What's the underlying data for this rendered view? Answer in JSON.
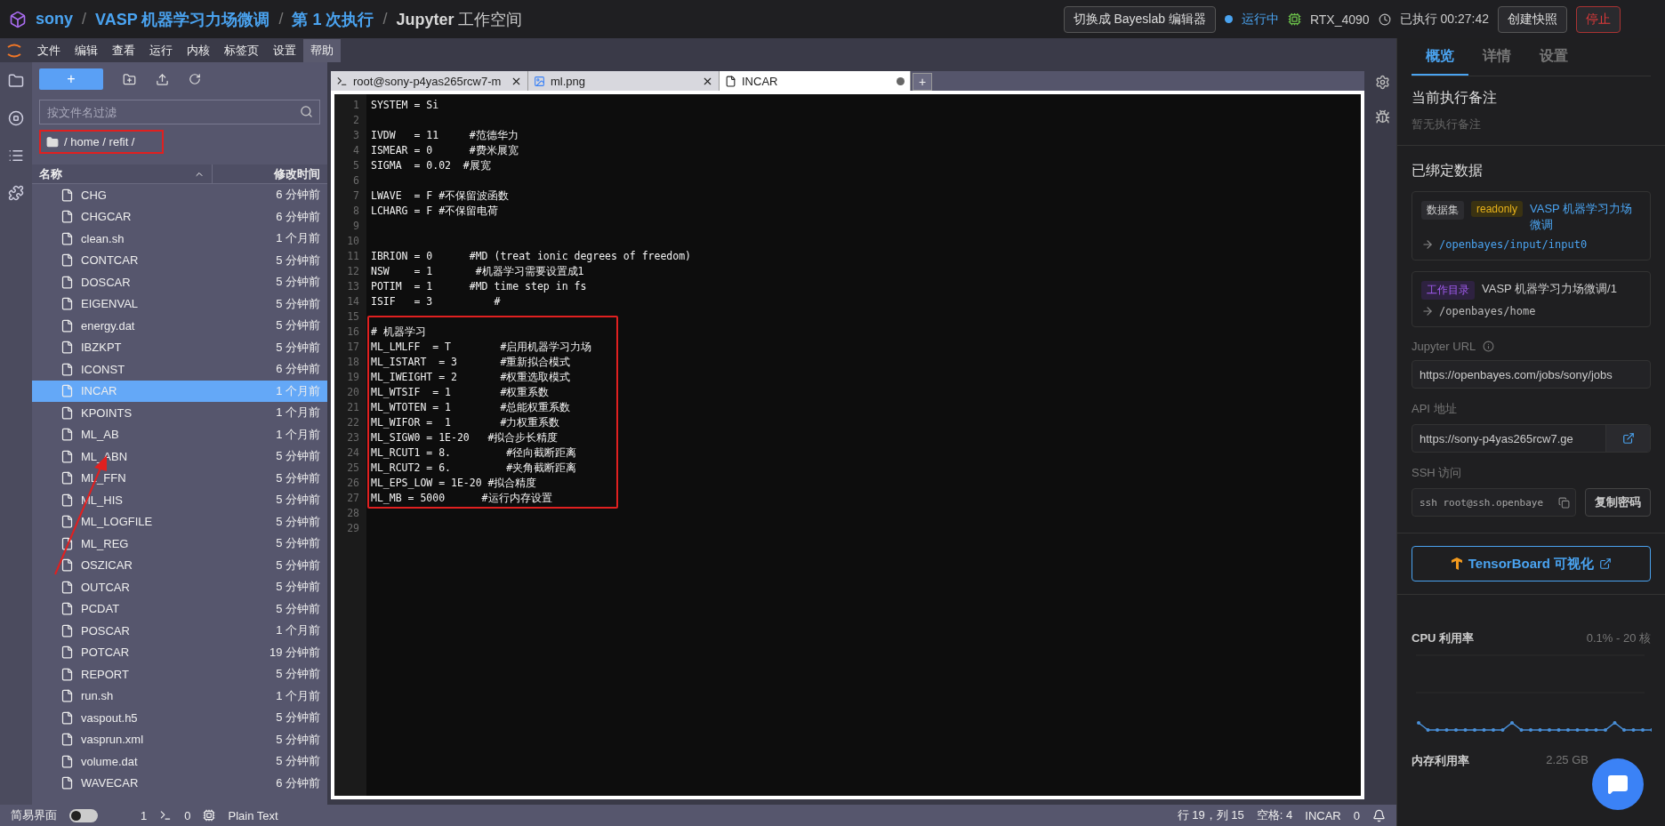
{
  "top_bar": {
    "breadcrumb": [
      {
        "text": "sony"
      },
      {
        "text": "VASP 机器学习力场微调"
      },
      {
        "text": "第 1 次执行"
      },
      {
        "text": "**Jupyter** 工作空间"
      }
    ],
    "separator": "/",
    "switch_button": "切换成 Bayeslab 编辑器",
    "status": {
      "label": "运行中",
      "color": "#4aa3f0"
    },
    "gpu": "RTX_4090",
    "elapsed": "已执行 00:27:42",
    "snapshot_button": "创建快照",
    "stop_button": "停止"
  },
  "menu": [
    {
      "label": "文件",
      "selected": false
    },
    {
      "label": "编辑",
      "selected": false
    },
    {
      "label": "查看",
      "selected": false
    },
    {
      "label": "运行",
      "selected": false
    },
    {
      "label": "内核",
      "selected": false
    },
    {
      "label": "标签页",
      "selected": false
    },
    {
      "label": "设置",
      "selected": false
    },
    {
      "label": "帮助",
      "selected": true
    }
  ],
  "file_browser": {
    "new_button": "+",
    "filter": {
      "placeholder": "按文件名过滤"
    },
    "path": "/ home / refit /",
    "columns": [
      "名称",
      "修改时间"
    ],
    "files": [
      {
        "name": "CHG",
        "modified": "6 分钟前",
        "selected": false
      },
      {
        "name": "CHGCAR",
        "modified": "6 分钟前",
        "selected": false
      },
      {
        "name": "clean.sh",
        "modified": "1 个月前",
        "selected": false
      },
      {
        "name": "CONTCAR",
        "modified": "5 分钟前",
        "selected": false
      },
      {
        "name": "DOSCAR",
        "modified": "5 分钟前",
        "selected": false
      },
      {
        "name": "EIGENVAL",
        "modified": "5 分钟前",
        "selected": false
      },
      {
        "name": "energy.dat",
        "modified": "5 分钟前",
        "selected": false
      },
      {
        "name": "IBZKPT",
        "modified": "5 分钟前",
        "selected": false
      },
      {
        "name": "ICONST",
        "modified": "6 分钟前",
        "selected": false
      },
      {
        "name": "INCAR",
        "modified": "1 个月前",
        "selected": true
      },
      {
        "name": "KPOINTS",
        "modified": "1 个月前",
        "selected": false
      },
      {
        "name": "ML_AB",
        "modified": "1 个月前",
        "selected": false
      },
      {
        "name": "ML_ABN",
        "modified": "5 分钟前",
        "selected": false
      },
      {
        "name": "ML_FFN",
        "modified": "5 分钟前",
        "selected": false
      },
      {
        "name": "ML_HIS",
        "modified": "5 分钟前",
        "selected": false
      },
      {
        "name": "ML_LOGFILE",
        "modified": "5 分钟前",
        "selected": false
      },
      {
        "name": "ML_REG",
        "modified": "5 分钟前",
        "selected": false
      },
      {
        "name": "OSZICAR",
        "modified": "5 分钟前",
        "selected": false
      },
      {
        "name": "OUTCAR",
        "modified": "5 分钟前",
        "selected": false
      },
      {
        "name": "PCDAT",
        "modified": "5 分钟前",
        "selected": false
      },
      {
        "name": "POSCAR",
        "modified": "1 个月前",
        "selected": false
      },
      {
        "name": "POTCAR",
        "modified": "19 分钟前",
        "selected": false
      },
      {
        "name": "REPORT",
        "modified": "5 分钟前",
        "selected": false
      },
      {
        "name": "run.sh",
        "modified": "1 个月前",
        "selected": false
      },
      {
        "name": "vaspout.h5",
        "modified": "5 分钟前",
        "selected": false
      },
      {
        "name": "vasprun.xml",
        "modified": "5 分钟前",
        "selected": false
      },
      {
        "name": "volume.dat",
        "modified": "5 分钟前",
        "selected": false
      },
      {
        "name": "WAVECAR",
        "modified": "6 分钟前",
        "selected": false
      }
    ]
  },
  "editor": {
    "tabs": [
      {
        "kind": "terminal",
        "label": "root@sony-p4yas265rcw7-m",
        "selected": false,
        "dirty": false
      },
      {
        "kind": "image",
        "label": "ml.png",
        "selected": false,
        "dirty": false
      },
      {
        "kind": "file",
        "label": "INCAR",
        "selected": true,
        "dirty": true
      }
    ],
    "add_tab": "+",
    "lines": [
      {
        "no": "1",
        "text": "SYSTEM = Si"
      },
      {
        "no": "2"
      },
      {
        "no": "3",
        "text": "IVDW   = 11     #范德华力"
      },
      {
        "no": "4",
        "text": "ISMEAR = 0      #费米展宽"
      },
      {
        "no": "5",
        "text": "SIGMA  = 0.02  #展宽"
      },
      {
        "no": "6"
      },
      {
        "no": "7",
        "text": "LWAVE  = F #不保留波函数"
      },
      {
        "no": "8",
        "text": "LCHARG = F #不保留电荷"
      },
      {
        "no": "9"
      },
      {
        "no": "10"
      },
      {
        "no": "11",
        "text": "IBRION = 0      #MD (treat ionic degrees of freedom)"
      },
      {
        "no": "12",
        "text": "NSW    = 1       #机器学习需要设置成1"
      },
      {
        "no": "13",
        "text": "POTIM  = 1      #MD time step in fs"
      },
      {
        "no": "14",
        "text": "ISIF   = 3          #"
      },
      {
        "no": "15"
      },
      {
        "no": "16",
        "text": "# 机器学习"
      },
      {
        "no": "17",
        "text": "ML_LMLFF  = T        #启用机器学习力场"
      },
      {
        "no": "18",
        "text": "ML_ISTART  = 3       #重新拟合模式"
      },
      {
        "no": "19",
        "text": "ML_IWEIGHT = 2       #权重选取模式"
      },
      {
        "no": "20",
        "text": "ML_WTSIF  = 1        #权重系数"
      },
      {
        "no": "21",
        "text": "ML_WTOTEN = 1        #总能权重系数"
      },
      {
        "no": "22",
        "text": "ML_WIFOR =  1        #力权重系数"
      },
      {
        "no": "23",
        "text": "ML_SIGW0 = 1E-20   #拟合步长精度"
      },
      {
        "no": "24",
        "text": "ML_RCUT1 = 8.         #径向截断距离"
      },
      {
        "no": "25",
        "text": "ML_RCUT2 = 6.         #夹角截断距离"
      },
      {
        "no": "26",
        "text": "ML_EPS_LOW = 1E-20 #拟合精度"
      },
      {
        "no": "27",
        "text": "ML_MB = 5000      #运行内存设置"
      },
      {
        "no": "28"
      },
      {
        "no": "29"
      }
    ]
  },
  "status_bar": {
    "simple_mode": {
      "label": "简易界面",
      "on": false
    },
    "terminals": "1",
    "kernels": "0",
    "language": "Plain Text",
    "position": "行 19，列 15",
    "indent": "空格: 4",
    "file": "INCAR",
    "notifications": "0"
  },
  "side_panel": {
    "tabs": [
      {
        "label": "概览",
        "selected": true
      },
      {
        "label": "详情",
        "selected": false
      },
      {
        "label": "设置",
        "selected": false
      }
    ],
    "note_title": "当前执行备注",
    "note_empty": "暂无执行备注",
    "bound_title": "已绑定数据",
    "bindings": [
      {
        "tags": [
          {
            "label": "数据集",
            "kind": "plain"
          },
          {
            "label": "readonly",
            "kind": "warning"
          }
        ],
        "name": "VASP 机器学习力场微调",
        "link": true,
        "path": "/openbayes/input/input0"
      },
      {
        "tags": [
          {
            "label": "工作目录",
            "kind": "purple"
          }
        ],
        "name": "VASP 机器学习力场微调/1",
        "link": false,
        "path": "/openbayes/home"
      }
    ],
    "jupyter_url": {
      "label": "Jupyter URL",
      "value": "https://openbayes.com/jobs/sony/jobs"
    },
    "api": {
      "label": "API 地址",
      "value": "https://sony-p4yas265rcw7.ge"
    },
    "ssh": {
      "label": "SSH 访问",
      "value": "ssh root@ssh.openbaye",
      "button": "复制密码"
    },
    "tensorboard": "TensorBoard 可视化",
    "cpu": {
      "label": "CPU 利用率",
      "reading": "0.1% - 20 核"
    },
    "memory": {
      "label": "内存利用率",
      "reading": "2.25 GB"
    }
  }
}
